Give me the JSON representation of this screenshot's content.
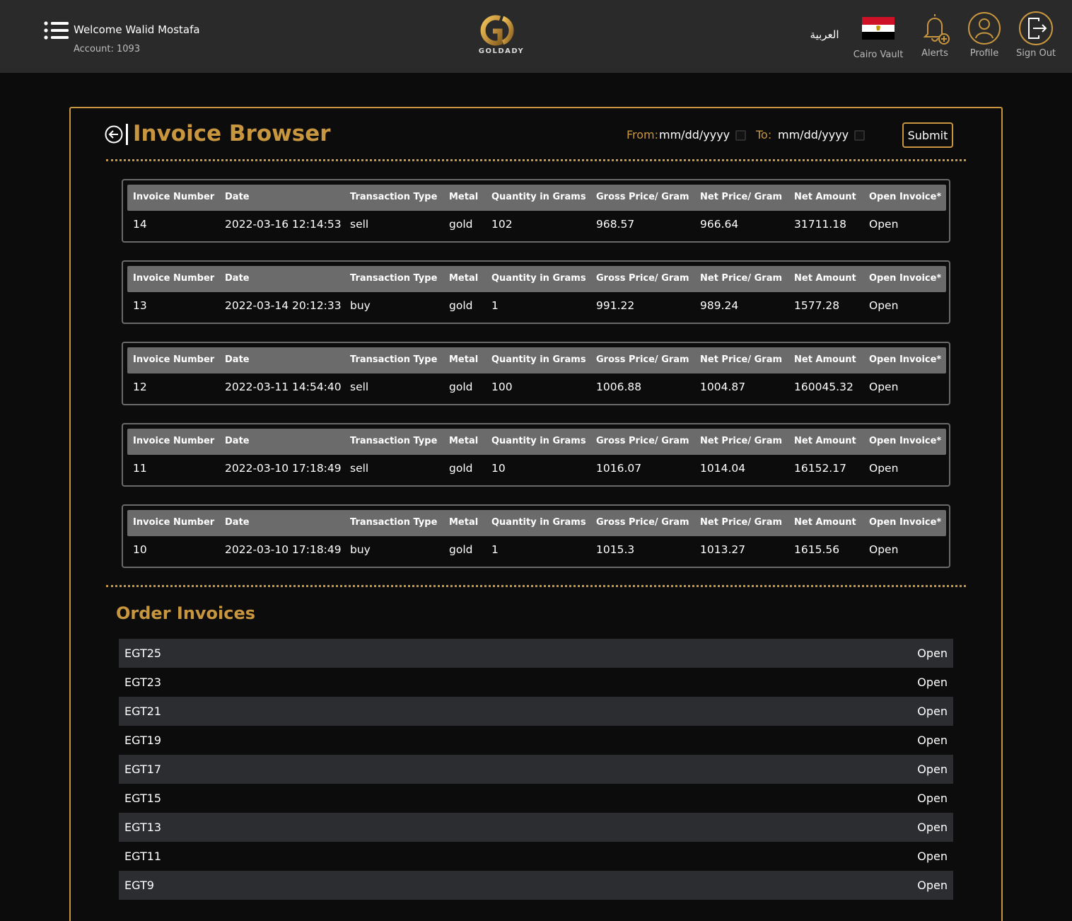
{
  "header": {
    "welcome": "Welcome Walid Mostafa",
    "account": "Account: 1093",
    "logo_text": "GOLDADY",
    "language": "العربية",
    "vault_label": "Cairo Vault",
    "alerts_label": "Alerts",
    "profile_label": "Profile",
    "signout_label": "Sign Out"
  },
  "colors": {
    "accent": "#c8963e",
    "header_bg": "#2a2a2a",
    "page_bg": "#0c0c0c",
    "table_header": "#6b6b6b",
    "row_alt": "#2b2d31"
  },
  "icons": [
    "menu-icon",
    "back-arrow-icon",
    "calendar-icon",
    "bell-plus-icon",
    "user-icon",
    "sign-out-icon",
    "egypt-flag-icon"
  ],
  "invoice_browser": {
    "title": "Invoice Browser",
    "from_label": "From:",
    "to_label": "To:",
    "from_value": "mm/dd/yyyy",
    "to_value": "mm/dd/yyyy",
    "submit_label": "Submit",
    "columns": [
      "Invoice Number",
      "Date",
      "Transaction Type",
      "Metal",
      "Quantity in Grams",
      "Gross Price/ Gram",
      "Net Price/ Gram",
      "Net Amount",
      "Open Invoice*"
    ],
    "invoices": [
      [
        "14",
        "2022-03-16 12:14:53",
        "sell",
        "gold",
        "102",
        "968.57",
        "966.64",
        "31711.18",
        "Open"
      ],
      [
        "13",
        "2022-03-14 20:12:33",
        "buy",
        "gold",
        "1",
        "991.22",
        "989.24",
        "1577.28",
        "Open"
      ],
      [
        "12",
        "2022-03-11 14:54:40",
        "sell",
        "gold",
        "100",
        "1006.88",
        "1004.87",
        "160045.32",
        "Open"
      ],
      [
        "11",
        "2022-03-10 17:18:49",
        "sell",
        "gold",
        "10",
        "1016.07",
        "1014.04",
        "16152.17",
        "Open"
      ],
      [
        "10",
        "2022-03-10 17:18:49",
        "buy",
        "gold",
        "1",
        "1015.3",
        "1013.27",
        "1615.56",
        "Open"
      ]
    ]
  },
  "order_invoices": {
    "title": "Order Invoices",
    "items": [
      {
        "code": "EGT25",
        "status": "Open"
      },
      {
        "code": "EGT23",
        "status": "Open"
      },
      {
        "code": "EGT21",
        "status": "Open"
      },
      {
        "code": "EGT19",
        "status": "Open"
      },
      {
        "code": "EGT17",
        "status": "Open"
      },
      {
        "code": "EGT15",
        "status": "Open"
      },
      {
        "code": "EGT13",
        "status": "Open"
      },
      {
        "code": "EGT11",
        "status": "Open"
      },
      {
        "code": "EGT9",
        "status": "Open"
      }
    ]
  }
}
